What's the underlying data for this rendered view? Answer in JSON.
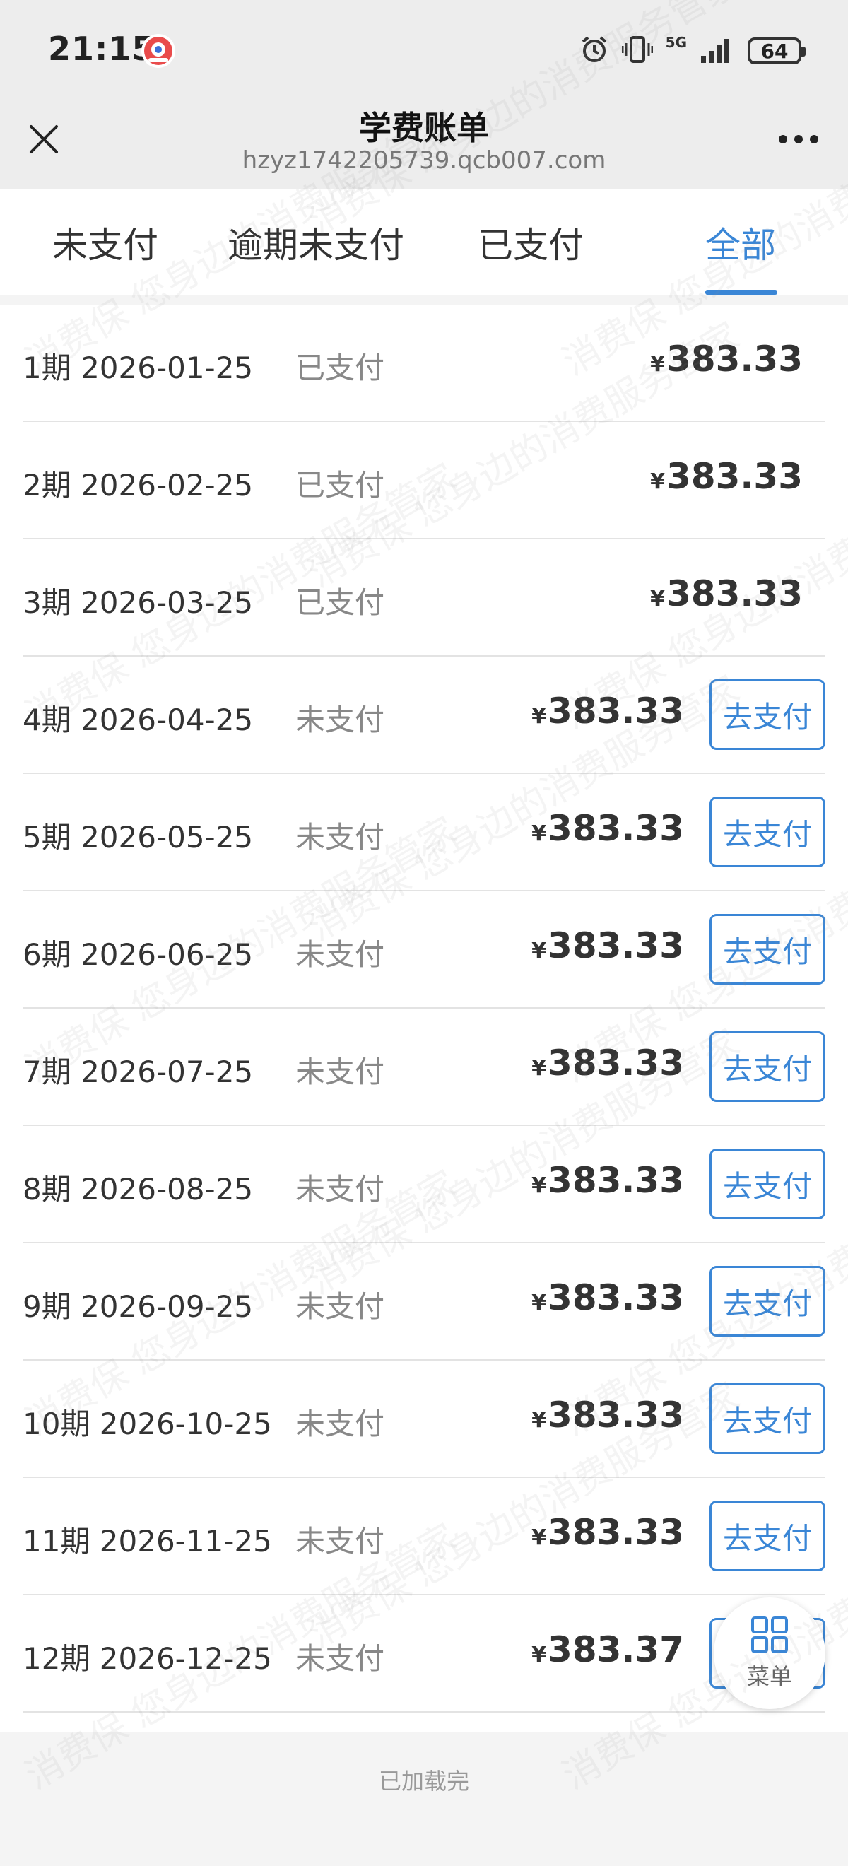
{
  "status_bar": {
    "time": "21:15",
    "network": "5G",
    "battery": "64"
  },
  "header": {
    "title": "学费账单",
    "url": "hzyz1742205739.qcb007.com"
  },
  "tabs": [
    {
      "label": "未支付",
      "active": false
    },
    {
      "label": "逾期未支付",
      "active": false
    },
    {
      "label": "已支付",
      "active": false
    },
    {
      "label": "全部",
      "active": true
    }
  ],
  "currency_symbol": "¥",
  "pay_button_label": "去支付",
  "bills": [
    {
      "period": "1期 2026-01-25",
      "status": "已支付",
      "amount": "383.33",
      "paid": true
    },
    {
      "period": "2期 2026-02-25",
      "status": "已支付",
      "amount": "383.33",
      "paid": true
    },
    {
      "period": "3期 2026-03-25",
      "status": "已支付",
      "amount": "383.33",
      "paid": true
    },
    {
      "period": "4期 2026-04-25",
      "status": "未支付",
      "amount": "383.33",
      "paid": false
    },
    {
      "period": "5期 2026-05-25",
      "status": "未支付",
      "amount": "383.33",
      "paid": false
    },
    {
      "period": "6期 2026-06-25",
      "status": "未支付",
      "amount": "383.33",
      "paid": false
    },
    {
      "period": "7期 2026-07-25",
      "status": "未支付",
      "amount": "383.33",
      "paid": false
    },
    {
      "period": "8期 2026-08-25",
      "status": "未支付",
      "amount": "383.33",
      "paid": false
    },
    {
      "period": "9期 2026-09-25",
      "status": "未支付",
      "amount": "383.33",
      "paid": false
    },
    {
      "period": "10期 2026-10-25",
      "status": "未支付",
      "amount": "383.33",
      "paid": false
    },
    {
      "period": "11期 2026-11-25",
      "status": "未支付",
      "amount": "383.33",
      "paid": false
    },
    {
      "period": "12期 2026-12-25",
      "status": "未支付",
      "amount": "383.37",
      "paid": false
    }
  ],
  "footer": {
    "loaded_text": "已加载完"
  },
  "floating_menu": {
    "label": "菜单"
  },
  "watermark": {
    "text": "消费保 您身边的消费服务管家"
  },
  "colors": {
    "accent": "#3a86d6",
    "header_bg": "#ededed"
  }
}
